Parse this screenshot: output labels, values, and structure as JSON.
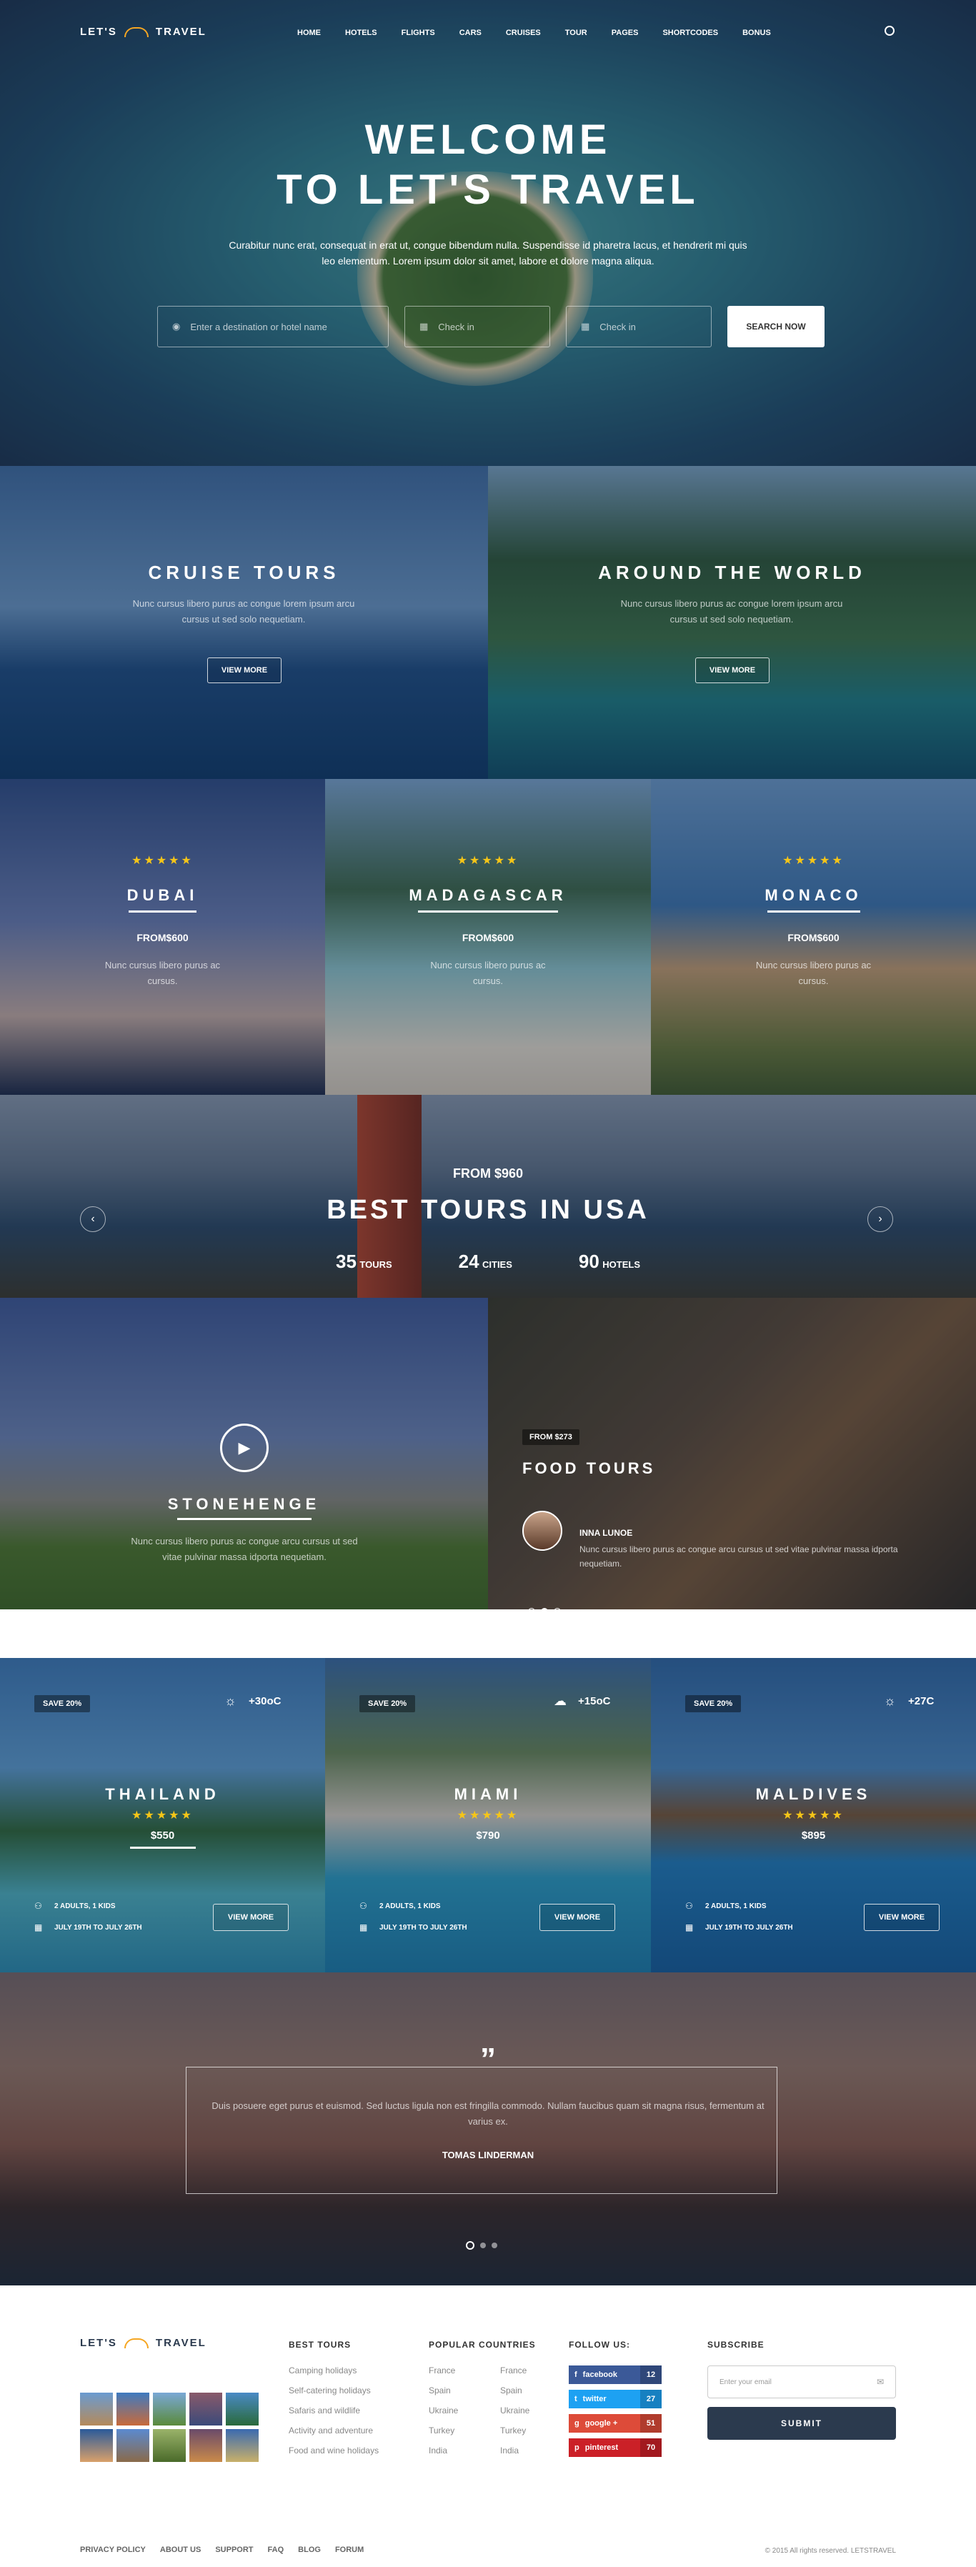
{
  "brand": {
    "name_left": "LET'S",
    "name_right": "TRAVEL"
  },
  "nav": {
    "items": [
      "HOME",
      "HOTELS",
      "FLIGHTS",
      "CARS",
      "CRUISES",
      "TOUR",
      "PAGES",
      "SHORTCODES",
      "BONUS"
    ]
  },
  "hero": {
    "line1": "WELCOME",
    "line2": "TO LET'S TRAVEL",
    "text": "Curabitur nunc erat, consequat in erat ut, congue bibendum nulla. Suspendisse id pharetra lacus, et hendrerit mi quis leo elementum. Lorem ipsum dolor sit amet, labore et dolore magna aliqua.",
    "destination_placeholder": "Enter a destination or hotel name",
    "checkin_placeholder": "Check in",
    "checkout_placeholder": "Check in",
    "search_label": "SEARCH NOW"
  },
  "promo": [
    {
      "title": "CRUISE TOURS",
      "text": "Nunc cursus libero purus ac congue lorem ipsum arcu cursus ut sed solo nequetiam.",
      "button": "VIEW MORE"
    },
    {
      "title": "AROUND THE WORLD",
      "text": "Nunc cursus libero purus ac congue lorem ipsum arcu cursus ut sed solo nequetiam.",
      "button": "VIEW MORE"
    }
  ],
  "destinations": [
    {
      "name": "DUBAI",
      "price": "FROM$600",
      "text": "Nunc cursus libero purus ac cursus."
    },
    {
      "name": "MADAGASCAR",
      "price": "FROM$600",
      "text": "Nunc cursus libero purus ac cursus."
    },
    {
      "name": "MONACO",
      "price": "FROM$600",
      "text": "Nunc cursus libero purus ac cursus."
    }
  ],
  "usa": {
    "from": "FROM $960",
    "title": "BEST TOURS IN USA",
    "tours_num": "35",
    "tours_label": "TOURS",
    "cities_num": "24",
    "cities_label": "CITIES",
    "hotels_num": "90",
    "hotels_label": "HOTELS"
  },
  "stonehenge": {
    "title": "STONEHENGE",
    "text": "Nunc cursus libero purus ac congue arcu cursus ut sed vitae pulvinar massa idporta nequetiam."
  },
  "food": {
    "badge": "FROM $273",
    "title": "FOOD TOURS",
    "author": "INNA LUNOE",
    "text": "Nunc cursus libero purus ac congue arcu cursus ut sed vitae pulvinar massa idporta nequetiam."
  },
  "deals": [
    {
      "badge": "SAVE 20%",
      "temp": "+30oC",
      "name": "THAILAND",
      "price": "$550",
      "guests": "2 ADULTS, 1 KIDS",
      "dates": "JULY 19TH TO JULY 26TH",
      "button": "VIEW MORE"
    },
    {
      "badge": "SAVE 20%",
      "temp": "+15oC",
      "name": "MIAMI",
      "price": "$790",
      "guests": "2 ADULTS, 1 KIDS",
      "dates": "JULY 19TH TO JULY 26TH",
      "button": "VIEW MORE"
    },
    {
      "badge": "SAVE 20%",
      "temp": "+27C",
      "name": "MALDIVES",
      "price": "$895",
      "guests": "2 ADULTS, 1 KIDS",
      "dates": "JULY 19TH TO JULY 26TH",
      "button": "VIEW MORE"
    }
  ],
  "testimonial": {
    "quote_mark": "”",
    "text": "Duis posuere eget purus et euismod. Sed luctus ligula non est fringilla commodo. Nullam faucibus quam sit magna risus, fermentum at varius ex.",
    "author": "TOMAS LINDERMAN"
  },
  "footer": {
    "best_tours_title": "BEST TOURS",
    "best_tours": [
      "Camping holidays",
      "Self-catering holidays",
      "Safaris and wildlife",
      "Activity and adventure",
      "Food and wine holidays"
    ],
    "countries_title": "POPULAR COUNTRIES",
    "countries_a": [
      "France",
      "Spain",
      "Ukraine",
      "Turkey",
      "India"
    ],
    "countries_b": [
      "France",
      "Spain",
      "Ukraine",
      "Turkey",
      "India"
    ],
    "follow_title": "FOLLOW US:",
    "social": [
      {
        "name": "facebook",
        "count": "12",
        "color": "#3b5998"
      },
      {
        "name": "twitter",
        "count": "27",
        "color": "#1da1f2"
      },
      {
        "name": "google +",
        "count": "51",
        "color": "#dd4b39"
      },
      {
        "name": "pinterest",
        "count": "70",
        "color": "#cb2027"
      }
    ],
    "subscribe_title": "SUBSCRIBE",
    "email_placeholder": "Enter your email",
    "submit_label": "SUBMIT",
    "links": [
      "PRIVACY POLICY",
      "ABOUT US",
      "SUPPORT",
      "FAQ",
      "BLOG",
      "FORUM"
    ],
    "copyright": "© 2015 All rights reserved. LETSTRAVEL"
  },
  "colors": {
    "accent": "#f5c518",
    "dark_button": "#2b3a4e"
  }
}
